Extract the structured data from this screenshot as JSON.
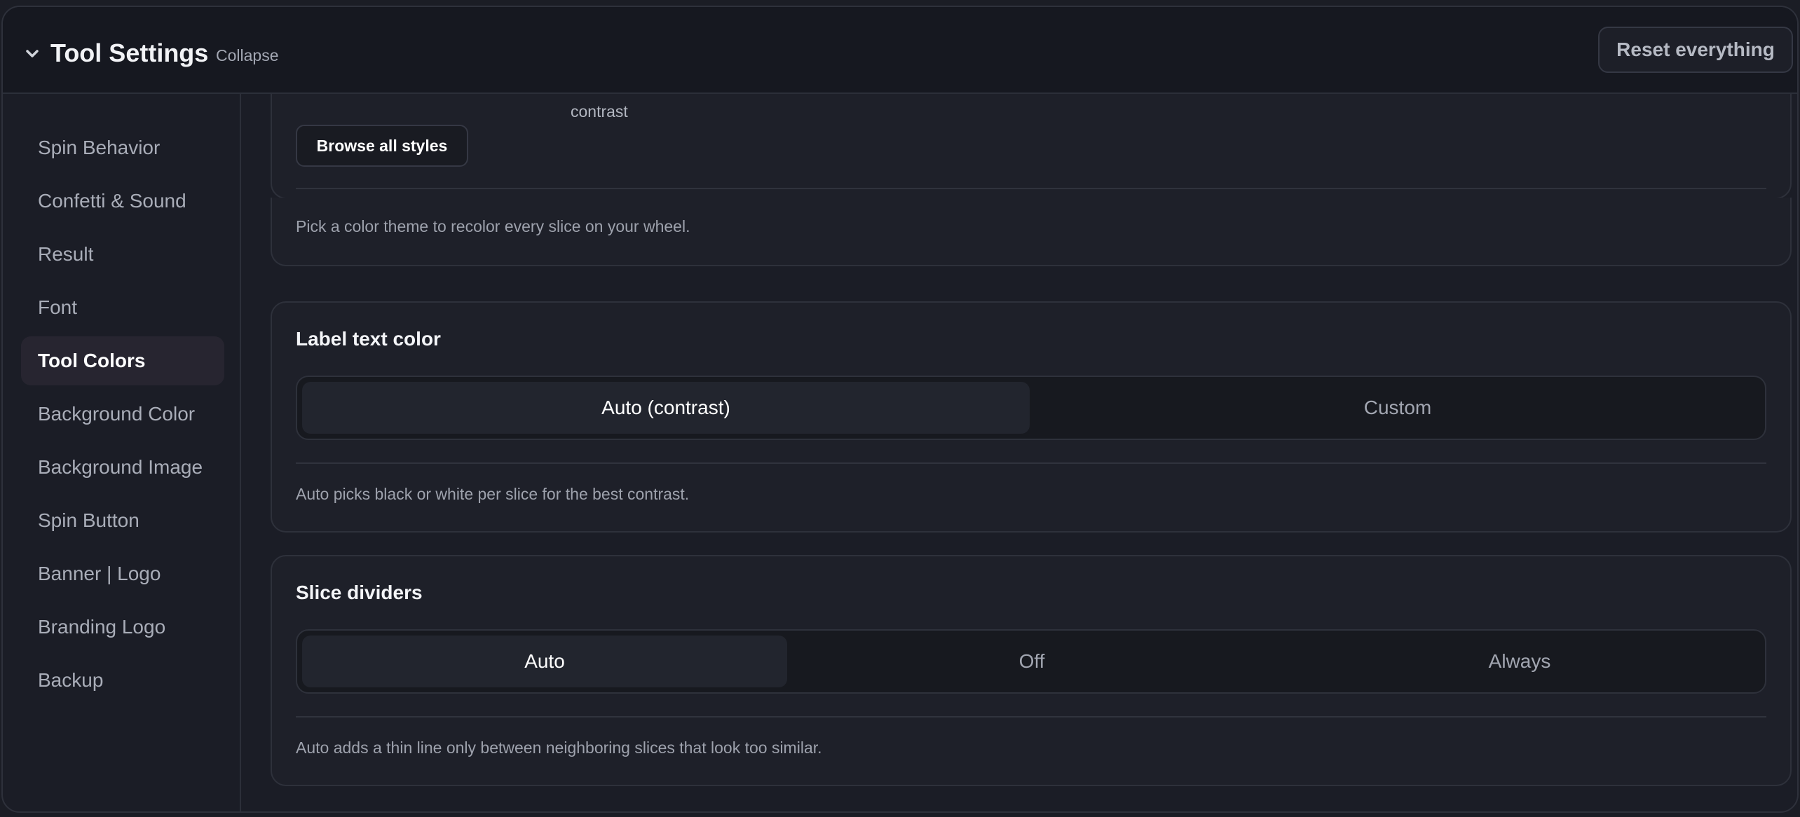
{
  "header": {
    "chevron_icon": "chevron-down-icon",
    "title": "Tool Settings",
    "collapse_label": "Collapse",
    "reset_label": "Reset everything"
  },
  "sidebar": {
    "items": [
      {
        "label": "Spin Behavior",
        "active": false
      },
      {
        "label": "Confetti & Sound",
        "active": false
      },
      {
        "label": "Result",
        "active": false
      },
      {
        "label": "Font",
        "active": false
      },
      {
        "label": "Tool Colors",
        "active": true
      },
      {
        "label": "Background Color",
        "active": false
      },
      {
        "label": "Background Image",
        "active": false
      },
      {
        "label": "Spin Button",
        "active": false
      },
      {
        "label": "Banner | Logo",
        "active": false
      },
      {
        "label": "Branding Logo",
        "active": false
      },
      {
        "label": "Backup",
        "active": false
      }
    ]
  },
  "theme_card": {
    "truncated_label": "contrast",
    "browse_label": "Browse all styles",
    "helper": "Pick a color theme to recolor every slice on your wheel."
  },
  "label_color_card": {
    "title": "Label text color",
    "options": [
      "Auto (contrast)",
      "Custom"
    ],
    "selected": "Auto (contrast)",
    "helper": "Auto picks black or white per slice for the best contrast."
  },
  "dividers_card": {
    "title": "Slice dividers",
    "options": [
      "Auto",
      "Off",
      "Always"
    ],
    "selected": "Auto",
    "helper": "Auto adds a thin line only between neighboring slices that look too similar."
  },
  "colors": {
    "background": "#1b1d26",
    "header": "#161820",
    "active_nav": "#272530",
    "text_primary": "#ffffff",
    "text_muted": "#a9adb8"
  }
}
